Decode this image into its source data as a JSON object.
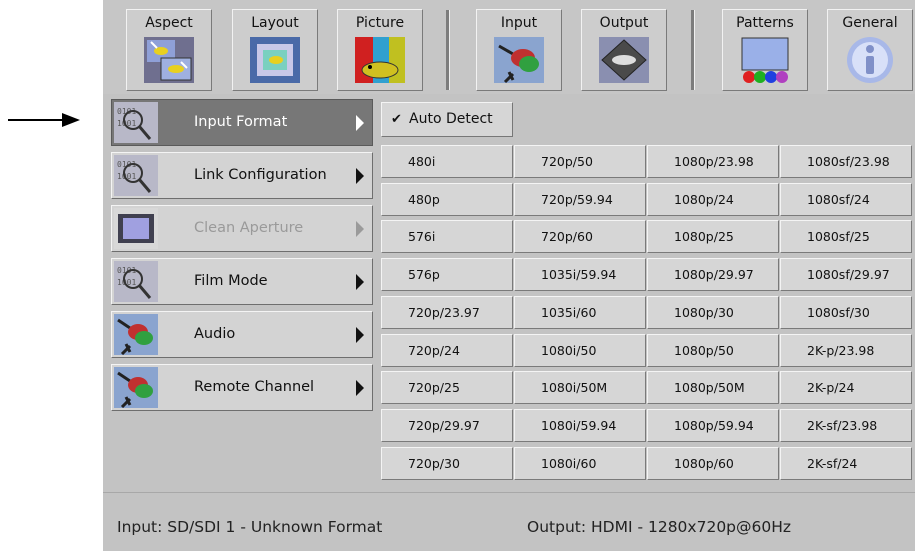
{
  "toolbar": {
    "buttons": [
      {
        "label": "Aspect",
        "icon": "aspect-icon"
      },
      {
        "label": "Layout",
        "icon": "layout-icon"
      },
      {
        "label": "Picture",
        "icon": "picture-icon"
      },
      {
        "label": "Input",
        "icon": "input-connector-icon"
      },
      {
        "label": "Output",
        "icon": "output-vxs-icon"
      },
      {
        "label": "Patterns",
        "icon": "patterns-icon"
      },
      {
        "label": "General",
        "icon": "info-icon"
      }
    ]
  },
  "menu": {
    "items": [
      {
        "label": "Input Format",
        "icon": "magnifier-binary-icon",
        "selected": true
      },
      {
        "label": "Link Configuration",
        "icon": "magnifier-binary-icon"
      },
      {
        "label": "Clean Aperture",
        "icon": "aperture-frame-icon",
        "disabled": true
      },
      {
        "label": "Film Mode",
        "icon": "magnifier-binary-icon"
      },
      {
        "label": "Audio",
        "icon": "rca-connector-icon"
      },
      {
        "label": "Remote Channel",
        "icon": "rca-connector-icon"
      }
    ]
  },
  "formats": {
    "auto_detect": {
      "check": "✔",
      "label": "Auto Detect",
      "checked": true
    },
    "rows": [
      [
        "480i",
        "720p/50",
        "1080p/23.98",
        "1080sf/23.98"
      ],
      [
        "480p",
        "720p/59.94",
        "1080p/24",
        "1080sf/24"
      ],
      [
        "576i",
        "720p/60",
        "1080p/25",
        "1080sf/25"
      ],
      [
        "576p",
        "1035i/59.94",
        "1080p/29.97",
        "1080sf/29.97"
      ],
      [
        "720p/23.97",
        "1035i/60",
        "1080p/30",
        "1080sf/30"
      ],
      [
        "720p/24",
        "1080i/50",
        "1080p/50",
        "2K-p/23.98"
      ],
      [
        "720p/25",
        "1080i/50M",
        "1080p/50M",
        "2K-p/24"
      ],
      [
        "720p/29.97",
        "1080i/59.94",
        "1080p/59.94",
        "2K-sf/23.98"
      ],
      [
        "720p/30",
        "1080i/60",
        "1080p/60",
        "2K-sf/24"
      ]
    ]
  },
  "status": {
    "input": "Input:   SD/SDI 1 - Unknown Format",
    "output": "Output: HDMI - 1280x720p@60Hz"
  },
  "colors": {
    "selected_menu": "#777777",
    "panel": "#c3c3c3",
    "button": "#d6d6d6"
  }
}
